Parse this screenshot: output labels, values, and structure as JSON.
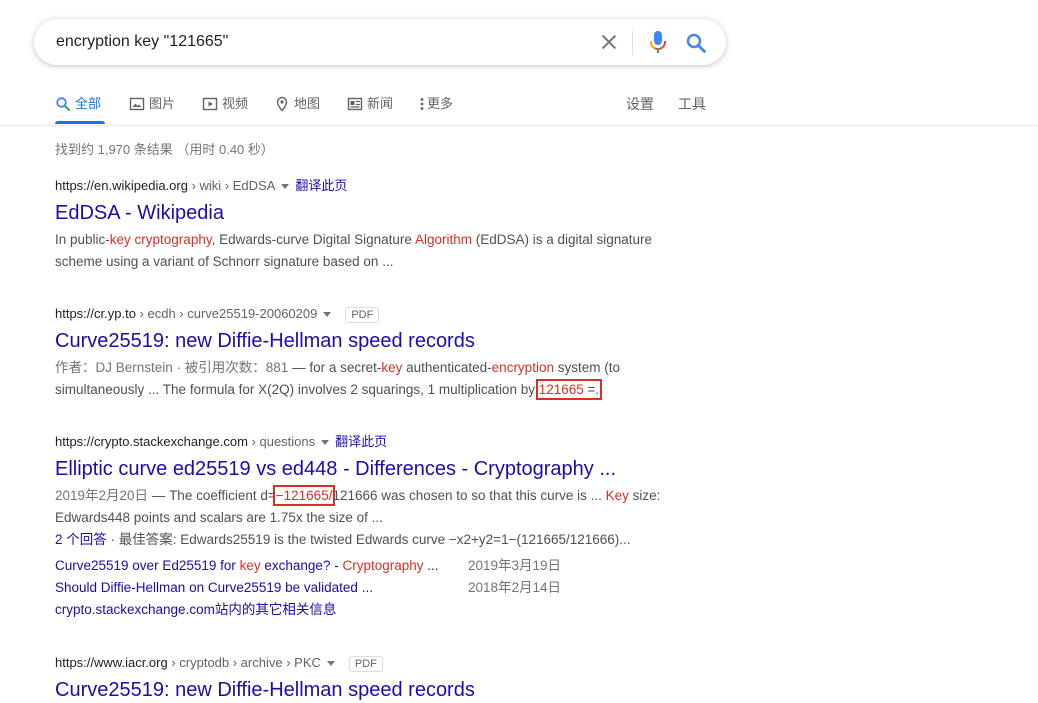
{
  "search": {
    "query": "encryption key \"121665\""
  },
  "tabs": [
    {
      "label": "全部",
      "icon": "search-icon"
    },
    {
      "label": "图片",
      "icon": "image-icon"
    },
    {
      "label": "视频",
      "icon": "play-icon"
    },
    {
      "label": "地图",
      "icon": "map-pin-icon"
    },
    {
      "label": "新闻",
      "icon": "newspaper-icon"
    },
    {
      "label": "更多",
      "icon": "more-vert-icon"
    }
  ],
  "tools": {
    "settings": "设置",
    "tools": "工具"
  },
  "stats": "找到约 1,970 条结果 （用时 0.40 秒）",
  "results": [
    {
      "url_host": "https://en.wikipedia.org",
      "url_path": " › wiki › EdDSA",
      "translate": "翻译此页",
      "title": "EdDSA - Wikipedia",
      "snippet": {
        "p1": "In public-",
        "h1": "key cryptography",
        "p2": ", Edwards-curve Digital Signature ",
        "h2": "Algorithm",
        "p3": " (EdDSA) is a digital signature scheme using a variant of Schnorr signature based on ..."
      }
    },
    {
      "url_host": "https://cr.yp.to",
      "url_path": " › ecdh › curve25519-20060209",
      "badge": "PDF",
      "title": "Curve25519: new Diffie-Hellman speed records",
      "snippet": {
        "meta": "作者：DJ Bernstein · 被引用次数：881",
        "p1": " — for a secret-",
        "h1": "key",
        "p2": " authenticated-",
        "h2": "encryption",
        "p3": " system (to simultaneously ... The formula for X(2Q) involves 2 squarings, 1 multiplication by ",
        "h3": "121665",
        "p4": " =."
      }
    },
    {
      "url_host": "https://crypto.stackexchange.com",
      "url_path": " › questions",
      "translate": "翻译此页",
      "title": "Elliptic curve ed25519 vs ed448 - Differences - Cryptography ...",
      "snippet": {
        "meta": "2019年2月20日",
        "p1": " — The coefficient d=",
        "h1": "−121665/",
        "p2": "121666 was chosen to so that this curve is ... ",
        "h2": "Key",
        "p3": " size: Edwards448 points and scalars are 1.75x the size of ...",
        "answers_link": "2 个回答",
        "answers_text": " · 最佳答案: Edwards25519 is the twisted Edwards curve −x2+y2=1−(121665/121666)..."
      },
      "sublinks": [
        {
          "p1": "Curve25519 over Ed25519 for ",
          "h1": "key",
          "p2": " exchange? - ",
          "h2": "Cryptography",
          "p3": " ...",
          "date": "2019年3月19日"
        },
        {
          "p1": "Should Diffie-Hellman on Curve25519 be validated ...",
          "date": "2018年2月14日"
        }
      ],
      "more": "crypto.stackexchange.com站内的其它相关信息"
    },
    {
      "url_host": "https://www.iacr.org",
      "url_path": " › cryptodb › archive › PKC",
      "badge": "PDF",
      "title": "Curve25519: new Diffie-Hellman speed records"
    }
  ],
  "colors": {
    "link": "#1a0dab",
    "highlight": "#d93025",
    "accent": "#1a73e8",
    "annotation_box": "#d93025"
  }
}
